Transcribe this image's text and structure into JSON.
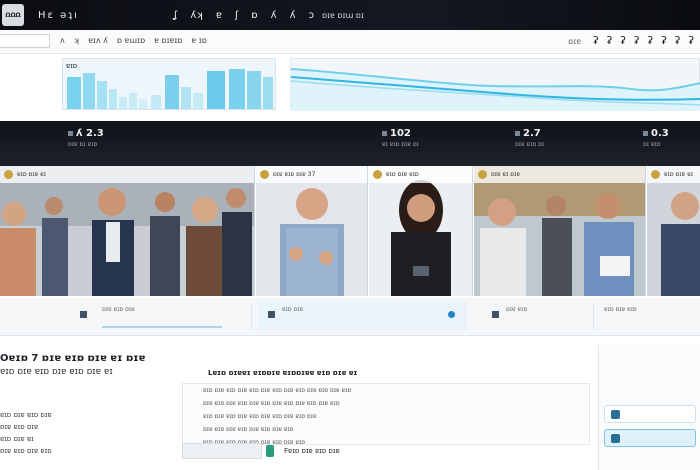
{
  "app": {
    "title": "Hɛ ǝʇı",
    "logo_text": "ΩΩΩ"
  },
  "topbar": {
    "menu": [
      "ʆ",
      "ʎʞ",
      "ɐ",
      "ʃ",
      "ɒ",
      "ʎ",
      "ʎ",
      "ɔ"
    ],
    "right": "ɒɪɐ ɒɪɯ ɒɪ"
  },
  "secondbar": {
    "menu": [
      "ʌ",
      "ʞ",
      "ɐɪʌ ʎ",
      "ɒ ɐɯɪɒ",
      "ɐ ɒɪɐɪɒ",
      "ɐ ɪɒ"
    ],
    "small": "ɒɪɐ",
    "nav": [
      "ʡ",
      "ʡ",
      "ʡ",
      "ʡ",
      "ʡ",
      "ʡ",
      "ʡ",
      "ʡ"
    ]
  },
  "chart1": {
    "label": "ɐɪɒ"
  },
  "stats": [
    {
      "value": "ʎ 2.3",
      "sub": "ɒɪɐ ɒɪ ɐɪɒ"
    },
    {
      "value": "102",
      "sub": "ɐɪ ɐɪɒ ɒɪɐ ɒɪ"
    },
    {
      "value": "2.7",
      "sub": "ɒɪɐ ɐɪɒ ɒɪ"
    },
    {
      "value": "0.3",
      "sub": "ɒɪ ɐɪɒ"
    }
  ],
  "cards": [
    {
      "caption": "ɐɪɒ ɒɪɐ ɐɪ"
    },
    {
      "caption": "ɒɪɐ ɐɪɒ ɒɪɐ 37"
    },
    {
      "caption": "ɐɪɒ ɒɪɐ ɐɪɒ"
    },
    {
      "caption": "ɒɪɐ ɐɪ ɒɪɐ"
    },
    {
      "caption": "ɐɪɒ ɒɪɐ ɐɪ"
    }
  ],
  "strip": [
    {
      "text": "ɒɪɐ ɐɪɒ ɒɪɐ"
    },
    {
      "text": "ɐɪɒ ɒɪɐ"
    },
    {
      "text": "ɒɪɐ ɐɪɒ"
    },
    {
      "text": "ɐɪɒ ɒɪɐ ɐɪɒ"
    }
  ],
  "bottom": {
    "heading1": "Oɐɪɒ 7 ɒɪɐ ɐɪɒ ɒɪɐ ɐɪ ɒɪɐ",
    "heading2": "ɐɪɒ ɒɪɐ ɐɪɒ ɒɪɐ ɐɪɒ ɒɪɐ ɐɪ",
    "heading3": "Lɐɪɒ ɒɪɐɐɪ ɐɪɒɒɪɐ ɐɪɒɒɪɐɐ ɐɪɒ ɒɪɐ ɐɪ",
    "list": [
      "ɐɪɒ ɒɪɐ ɐɪɒ ɒɪɐ",
      "ɒɪɐ ɐɪɒ ɒɪɐ",
      "ɐɪɒ ɒɪɐ ɐɪ",
      "ɒɪɐ ɐɪɒ ɒɪɐ ɐɪɒ"
    ],
    "box_lines": [
      "ɐɪɒ ɒɪɐ ɐɪɒ ɒɪɐ ɐɪɒ ɒɪɐ ɐɪɒ ɒɪɐ ɐɪɒ ɒɪɐ ɐɪɒ ɒɪɐ ɐɪɒ",
      "ɒɪɐ ɐɪɒ ɒɪɐ ɐɪɒ ɒɪɐ ɐɪɒ ɒɪɐ ɐɪɒ ɒɪɐ ɐɪɒ ɒɪɐ ɐɪɒ",
      "ɐɪɒ ɒɪɐ ɐɪɒ ɒɪɐ ɐɪɒ ɒɪɐ ɐɪɒ ɒɪɐ ɐɪɒ ɒɪɐ",
      "ɒɪɐ ɐɪɒ ɒɪɐ ɐɪɒ ɒɪɐ ɐɪɒ ɒɪɐ ɐɪɒ",
      "ɐɪɒ ɒɪɐ ɐɪɒ ɒɪɐ ɐɪɒ ɒɪɐ ɐɪɒ ɒɪɐ ɐɪɒ",
      "ɒɪɐ ɐɪɒ ɒɪɐ ɐɪɒ ɒɪɐ"
    ],
    "foot_label": "Fɐɪɒ ɒɪɐ ɐɪɒ ɒɪɐ"
  },
  "colors": {
    "topbar_bg": "#0b0d12",
    "band_bg": "#101319",
    "chart_fill": "#6fd0ee",
    "accent": "#2a6e95"
  }
}
